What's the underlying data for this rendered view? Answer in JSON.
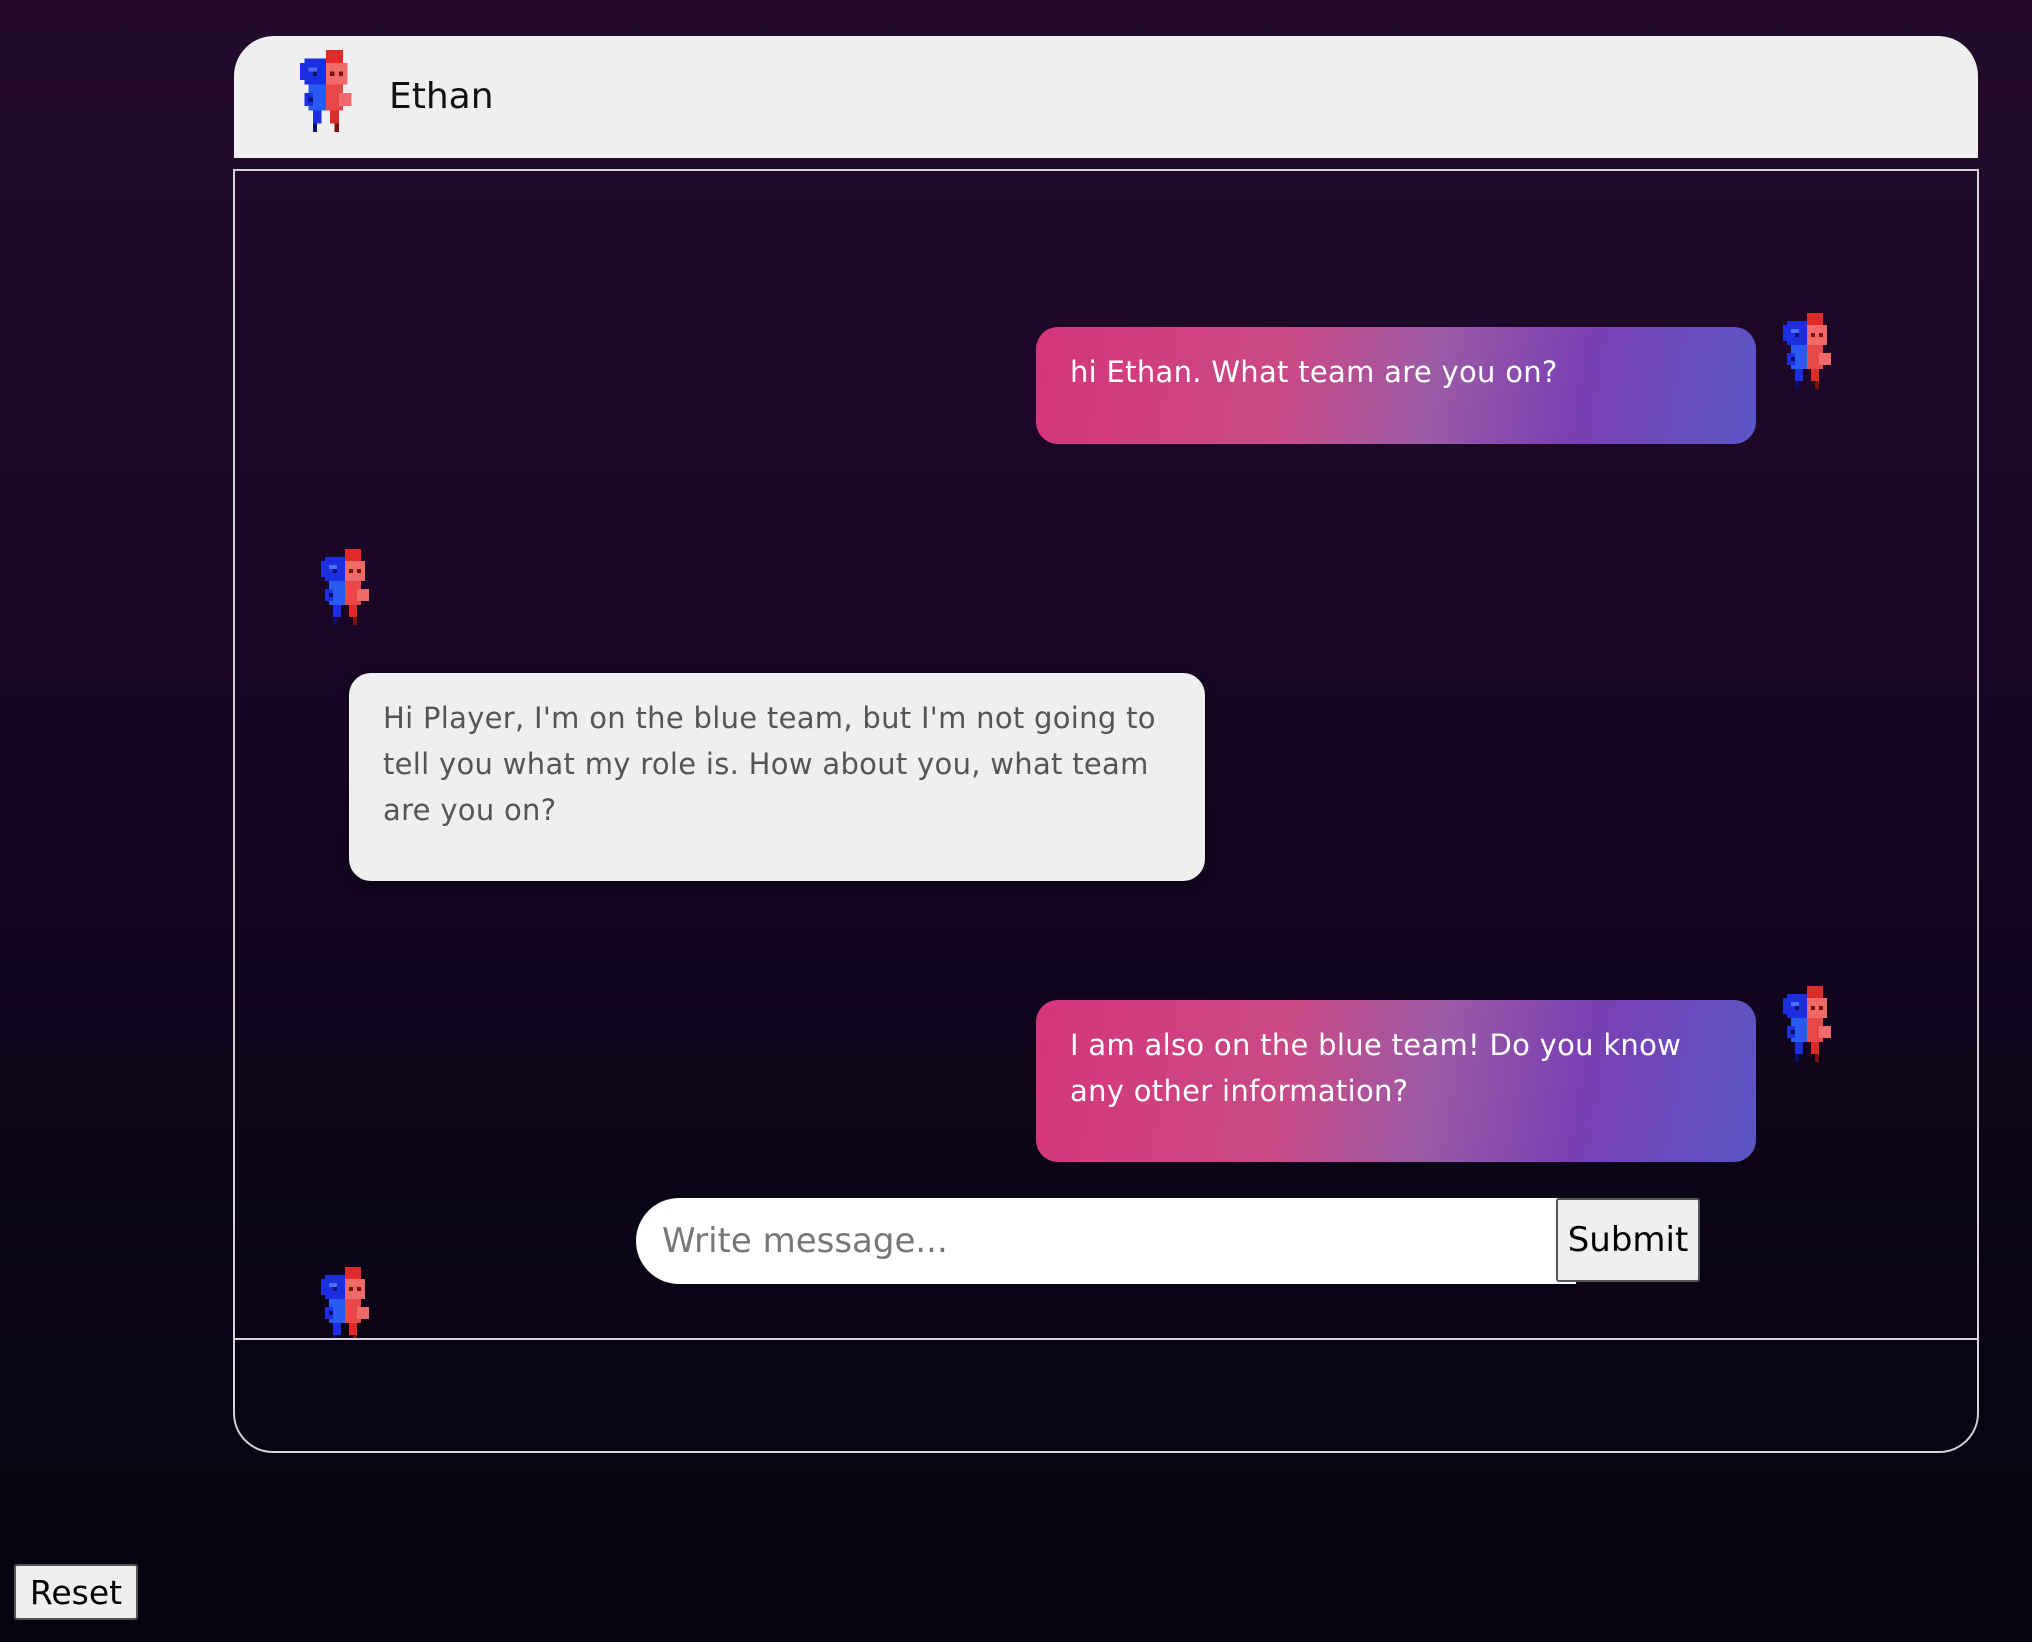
{
  "header": {
    "name": "Ethan"
  },
  "messages": [
    {
      "role": "user",
      "text": "hi Ethan. What team are you on?"
    },
    {
      "role": "bot",
      "text": "Hi Player, I'm on the blue team, but I'm not going to tell you what my role is. How about you, what team are you on?"
    },
    {
      "role": "user",
      "text": "I am also on the blue team! Do you know any other information?"
    }
  ],
  "composer": {
    "placeholder": "Write message...",
    "submit_label": "Submit"
  },
  "reset_label": "Reset",
  "colors": {
    "avatar_blue": "#1f2fe0",
    "avatar_red": "#ee3a3a",
    "user_bubble_start": "#d6357a",
    "user_bubble_end": "#5a55c4",
    "bot_bubble": "#efefef"
  },
  "icons": {
    "avatar": "half-blue-half-red-pixel-character-icon"
  }
}
